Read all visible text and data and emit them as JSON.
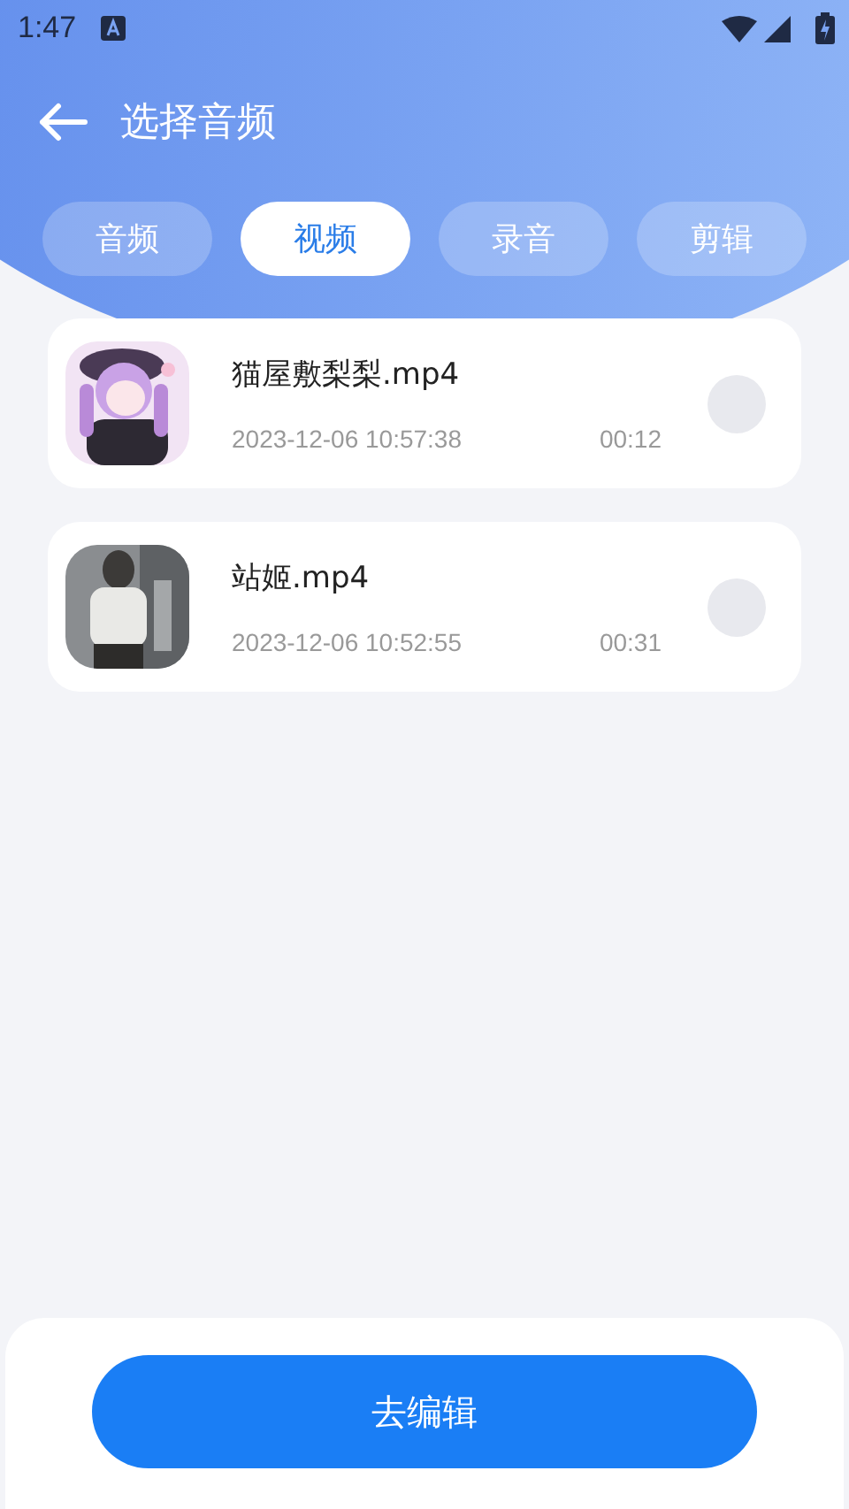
{
  "status_bar": {
    "time": "1:47"
  },
  "header": {
    "title": "选择音频"
  },
  "tabs": [
    {
      "label": "音频",
      "selected": false
    },
    {
      "label": "视频",
      "selected": true
    },
    {
      "label": "录音",
      "selected": false
    },
    {
      "label": "剪辑",
      "selected": false
    }
  ],
  "files": [
    {
      "name": "猫屋敷梨梨.mp4",
      "date": "2023-12-06 10:57:38",
      "duration": "00:12",
      "selected": false
    },
    {
      "name": "站姬.mp4",
      "date": "2023-12-06 10:52:55",
      "duration": "00:31",
      "selected": false
    }
  ],
  "action_button": "去编辑"
}
